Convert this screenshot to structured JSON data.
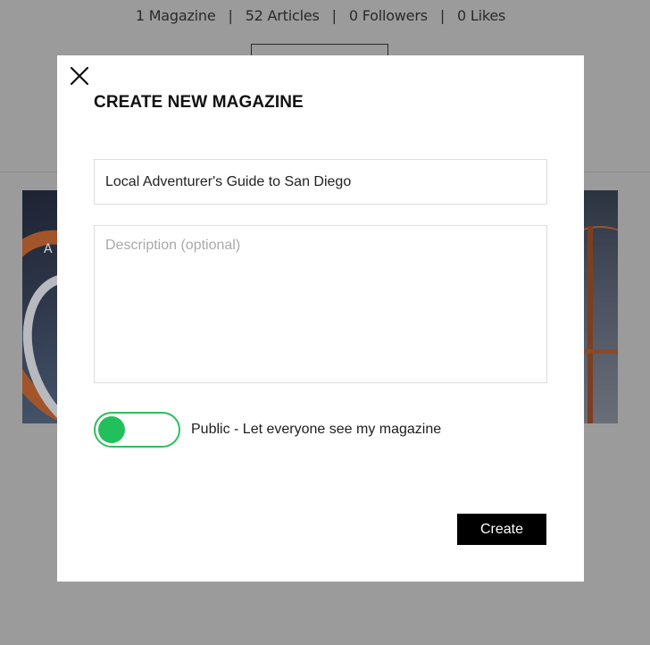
{
  "background": {
    "stats": {
      "magazines": "1 Magazine",
      "articles": "52 Articles",
      "followers": "0 Followers",
      "likes": "0 Likes",
      "separator": "|"
    },
    "left_card_text": "A"
  },
  "modal": {
    "title": "CREATE NEW MAGAZINE",
    "name_value": "Local Adventurer's Guide to San Diego",
    "description_value": "",
    "description_placeholder": "Description (optional)",
    "public_toggle": {
      "on": true,
      "label": "Public - Let everyone see my magazine",
      "accent_color": "#2dbe5c"
    },
    "create_label": "Create"
  }
}
